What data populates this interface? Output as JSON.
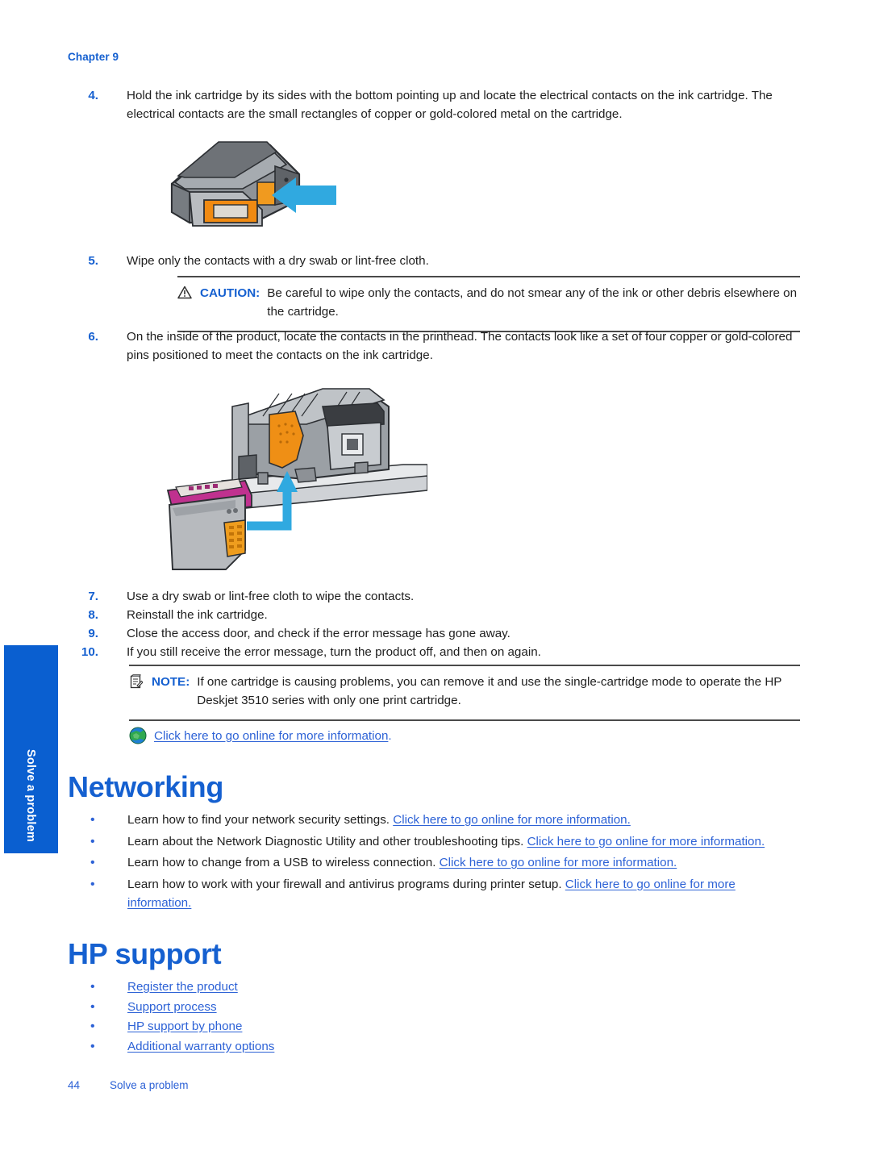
{
  "document": {
    "chapter_label": "Chapter 9",
    "footer": {
      "page_number": "44",
      "section_title": "Solve a problem"
    },
    "side_tab": {
      "label": "Solve a problem"
    }
  },
  "steps": [
    {
      "number": "4.",
      "text": "Hold the ink cartridge by its sides with the bottom pointing up and locate the electrical contacts on the ink cartridge. The electrical contacts are the small rectangles of copper or gold-colored metal on the cartridge."
    },
    {
      "number": "5.",
      "text": "Wipe only the contacts with a dry swab or lint-free cloth."
    },
    {
      "number": "6.",
      "text": "On the inside of the product, locate the contacts in the printhead. The contacts look like a set of four copper or gold-colored pins positioned to meet the contacts on the ink cartridge."
    },
    {
      "number": "7.",
      "text": "Use a dry swab or lint-free cloth to wipe the contacts."
    },
    {
      "number": "8.",
      "text": "Reinstall the ink cartridge."
    },
    {
      "number": "9.",
      "text": "Close the access door, and check if the error message has gone away."
    },
    {
      "number": "10.",
      "text": "If you still receive the error message, turn the product off, and then on again."
    }
  ],
  "caution": {
    "keyword": "CAUTION:",
    "text": "Be careful to wipe only the contacts, and do not smear any of the ink or other debris elsewhere on the cartridge."
  },
  "note": {
    "keyword": "NOTE:",
    "text": "If one cartridge is causing problems, you can remove it and use the single-cartridge mode to operate the HP Deskjet 3510 series with only one print cartridge."
  },
  "online_link": {
    "link_text": "Click here to go online for more information",
    "trailing": "."
  },
  "networking": {
    "heading": "Networking",
    "bullets": [
      {
        "bullet": "•",
        "lead": "Learn how to find your network security settings. ",
        "link": "Click here to go online for more information."
      },
      {
        "bullet": "•",
        "lead": "Learn about the Network Diagnostic Utility and other troubleshooting tips. ",
        "link": "Click here to go online for more information."
      },
      {
        "bullet": "•",
        "lead": "Learn how to change from a USB to wireless connection. ",
        "link": "Click here to go online for more information."
      },
      {
        "bullet": "•",
        "lead": "Learn how to work with your firewall and antivirus programs during printer setup. ",
        "link": "Click here to go online for more information."
      }
    ]
  },
  "hp_support": {
    "heading": "HP support",
    "bullets": [
      {
        "bullet": "•",
        "link": "Register the product"
      },
      {
        "bullet": "•",
        "link": "Support process"
      },
      {
        "bullet": "•",
        "link": "HP support by phone"
      },
      {
        "bullet": "•",
        "link": "Additional warranty options"
      }
    ]
  },
  "figures": {
    "cartridge_contacts": "ink-cartridge-electrical-contacts-illustration",
    "printhead_contacts": "printhead-contacts-and-cartridge-illustration"
  },
  "colors": {
    "heading_blue": "#1560d0",
    "link_blue": "#2d62d6",
    "tab_blue": "#0a5fd0",
    "rule_gray": "#4a4a4a"
  }
}
